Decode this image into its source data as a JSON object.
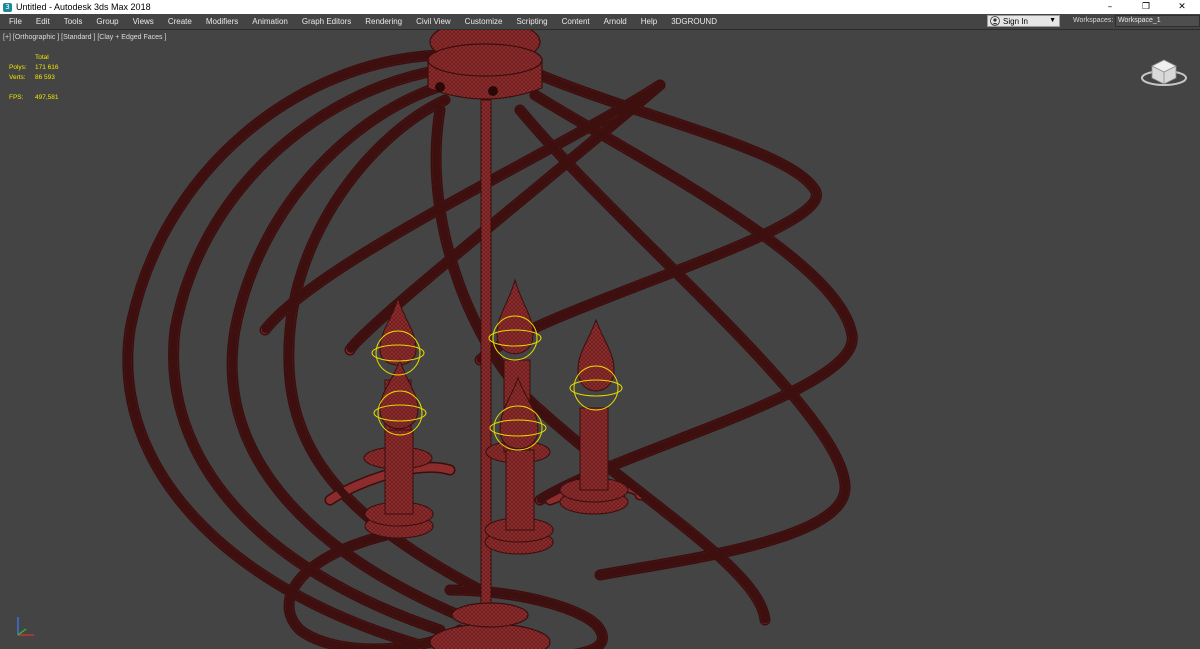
{
  "window": {
    "title": "Untitled - Autodesk 3ds Max 2018",
    "app_icon": "3",
    "controls": [
      "–",
      "❐",
      "✕"
    ]
  },
  "menu": {
    "items": [
      "File",
      "Edit",
      "Tools",
      "Group",
      "Views",
      "Create",
      "Modifiers",
      "Animation",
      "Graph Editors",
      "Rendering",
      "Civil View",
      "Customize",
      "Scripting",
      "Content",
      "Arnold",
      "Help",
      "3DGROUND"
    ]
  },
  "signin": {
    "label": "Sign In"
  },
  "workspaces": {
    "label": "Workspaces:",
    "value": "Workspace_1"
  },
  "viewport": {
    "label": "[+] [Orthographic ] [Standard ] [Clay + Edged Faces ]",
    "stats": {
      "total_label": "Total",
      "polys_label": "Polys:",
      "polys_value": "171 616",
      "verts_label": "Verts:",
      "verts_value": "86 593",
      "fps_label": "FPS:",
      "fps_value": "497,581"
    }
  },
  "colors": {
    "viewport_bg": "#444444",
    "model_red": "#8a2a2a",
    "wire_dark": "#3a0e0e",
    "selection_yellow": "#e8d800",
    "stats_yellow": "#f2e600"
  }
}
